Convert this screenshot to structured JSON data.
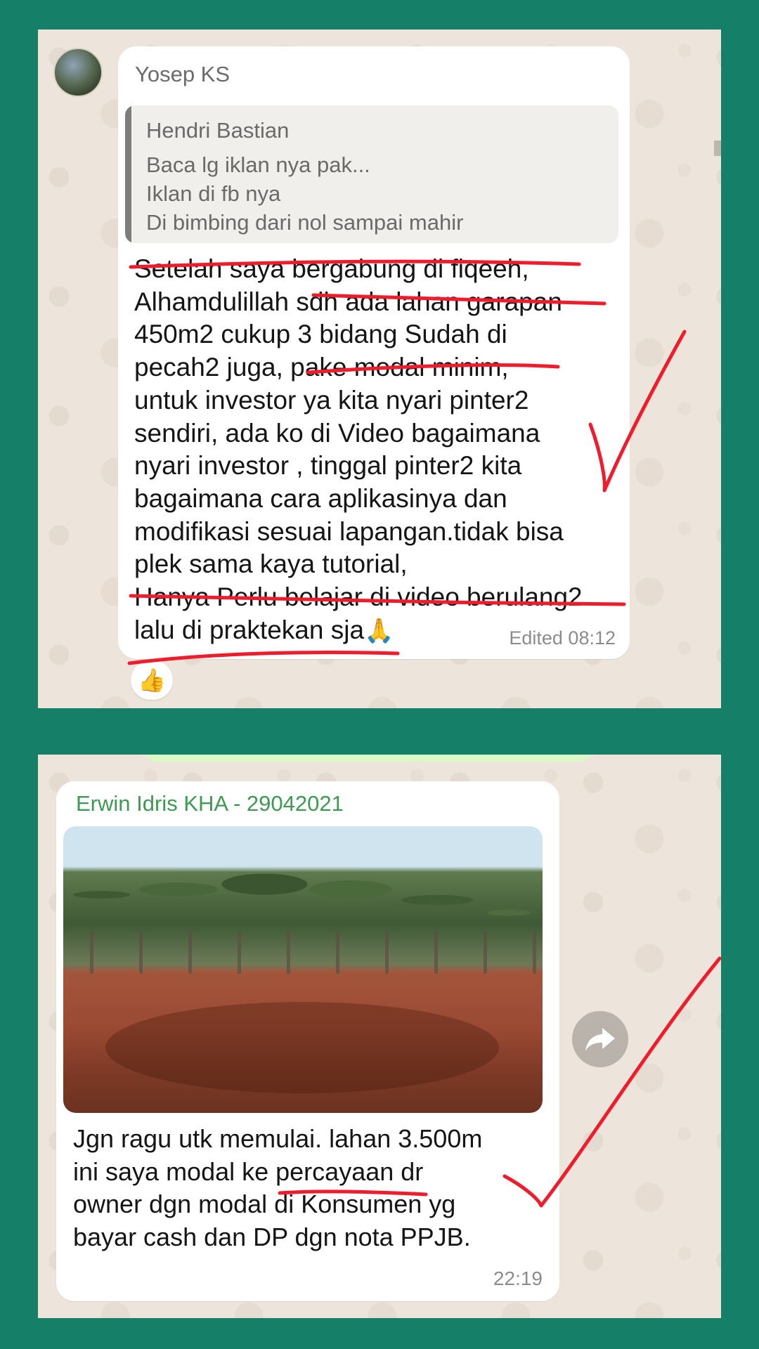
{
  "top_chat": {
    "sender": "Yosep KS",
    "quoted": {
      "author": "Hendri Bastian",
      "lines": [
        "Baca lg iklan nya pak...",
        "Iklan di fb nya",
        "Di bimbing dari nol sampai mahir"
      ]
    },
    "message_lines": [
      "Setelah saya bergabung di fiqeeh,",
      "Alhamdulillah sdh ada lahan garapan",
      "450m2 cukup 3 bidang Sudah di",
      "pecah2 juga, pake modal minim,",
      "untuk investor ya kita nyari pinter2",
      "sendiri, ada ko di Video bagaimana",
      "nyari investor , tinggal pinter2 kita",
      "bagaimana cara aplikasinya dan",
      "modifikasi sesuai lapangan.tidak bisa",
      "plek sama kaya tutorial,",
      "Hanya Perlu belajar di video berulang2",
      "lalu di praktekan sja"
    ],
    "emoji": "🙏",
    "edited_label": "Edited 08:12",
    "reaction": "👍"
  },
  "bottom_chat": {
    "sender": "Erwin Idris KHA - 29042021",
    "message_lines": [
      "Jgn ragu utk memulai. lahan 3.500m",
      "ini saya modal ke percayaan dr",
      "owner dgn modal di Konsumen yg",
      "bayar cash dan DP dgn nota PPJB."
    ],
    "time": "22:19"
  },
  "colors": {
    "outer_background": "#157f68",
    "chat_wallpaper": "#ede5dc",
    "annotation_red": "#f01c2c",
    "sender_green": "#3d9a52"
  },
  "icons": {
    "share": "share-forward-icon",
    "annotation": "checkmark-icon"
  }
}
